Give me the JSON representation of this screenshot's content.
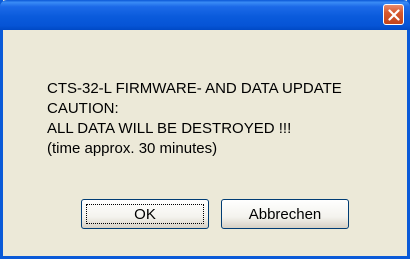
{
  "dialog": {
    "title": "",
    "close_icon": "close-icon",
    "message_lines": [
      "CTS-32-L FIRMWARE- AND DATA UPDATE",
      "CAUTION:",
      "ALL DATA WILL BE DESTROYED !!!",
      "(time approx. 30 minutes)"
    ],
    "ok_label": "OK",
    "cancel_label": "Abbrechen"
  },
  "colors": {
    "titlebar": "#0a5bdc",
    "close_button": "#d6582e",
    "window_background": "#ece9d8",
    "button_border": "#003c74"
  }
}
